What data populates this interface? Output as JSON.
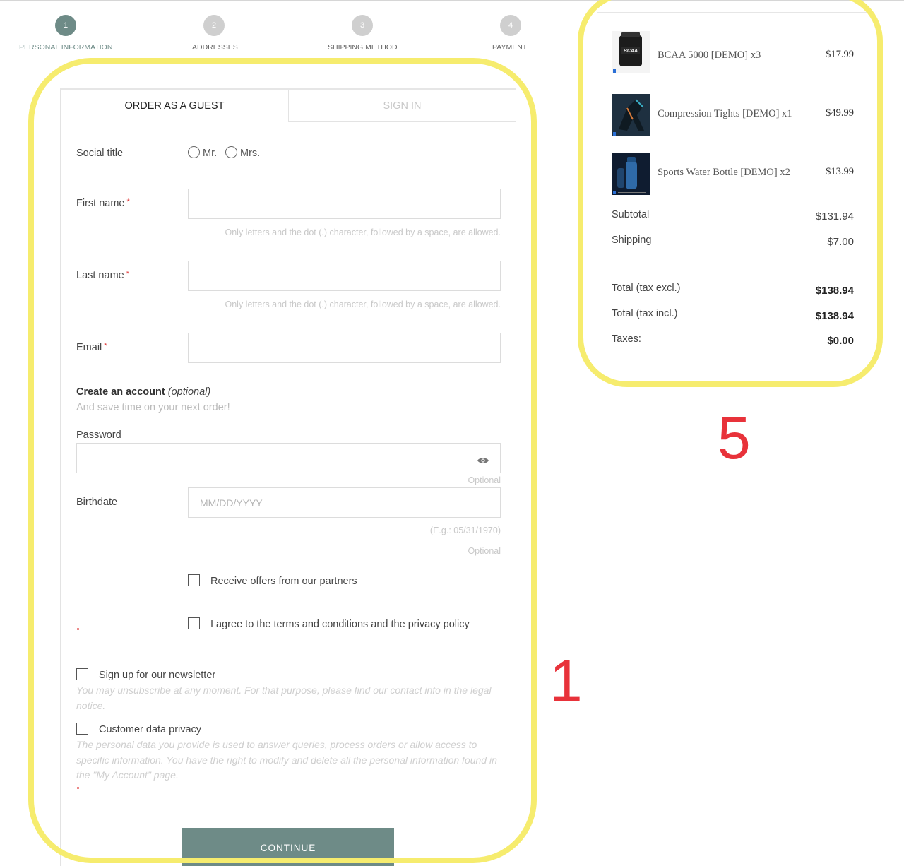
{
  "stepper": {
    "steps": [
      {
        "number": "1",
        "label": "PERSONAL INFORMATION"
      },
      {
        "number": "2",
        "label": "ADDRESSES"
      },
      {
        "number": "3",
        "label": "SHIPPING METHOD"
      },
      {
        "number": "4",
        "label": "PAYMENT"
      }
    ]
  },
  "tabs": {
    "guest": "ORDER AS A GUEST",
    "signin": "SIGN IN"
  },
  "form": {
    "social_title": "Social title",
    "mr": "Mr.",
    "mrs": "Mrs.",
    "first_name": "First name",
    "last_name": "Last name",
    "email": "Email",
    "required_mark": "*",
    "name_hint": "Only letters and the dot (.) character, followed by a space, are allowed.",
    "create_account": "Create an account",
    "optional_paren": "(optional)",
    "create_account_sub": "And save time on your next order!",
    "password": "Password",
    "optional": "Optional",
    "birthdate": "Birthdate",
    "birthdate_placeholder": "MM/DD/YYYY",
    "birthdate_example": "(E.g.: 05/31/1970)",
    "offers": "Receive offers from our partners",
    "terms": "I agree to the terms and conditions and the privacy policy",
    "newsletter": "Sign up for our newsletter",
    "newsletter_note": "You may unsubscribe at any moment. For that purpose, please find our contact info in the legal notice.",
    "privacy": "Customer data privacy",
    "privacy_note": "The personal data you provide is used to answer queries, process orders or allow access to specific information. You have the right to modify and delete all the personal information found in the \"My Account\" page.",
    "continue": "CONTINUE"
  },
  "cart": {
    "items": [
      {
        "name": "BCAA 5000 [DEMO] x3",
        "price": "$17.99"
      },
      {
        "name": "Compression Tights [DEMO] x1",
        "price": "$49.99"
      },
      {
        "name": "Sports Water Bottle [DEMO] x2",
        "price": "$13.99"
      }
    ],
    "subtotal_label": "Subtotal",
    "subtotal": "$131.94",
    "shipping_label": "Shipping",
    "shipping": "$7.00",
    "total_excl_label": "Total (tax excl.)",
    "total_excl": "$138.94",
    "total_incl_label": "Total (tax incl.)",
    "total_incl": "$138.94",
    "taxes_label": "Taxes:",
    "taxes": "$0.00"
  },
  "annotations": {
    "form_marker": "1",
    "summary_marker": "5"
  },
  "colors": {
    "accent": "#6e8b87",
    "highlight": "#f6ec6e",
    "annotation": "#e8323a",
    "required": "#e03a3a"
  }
}
